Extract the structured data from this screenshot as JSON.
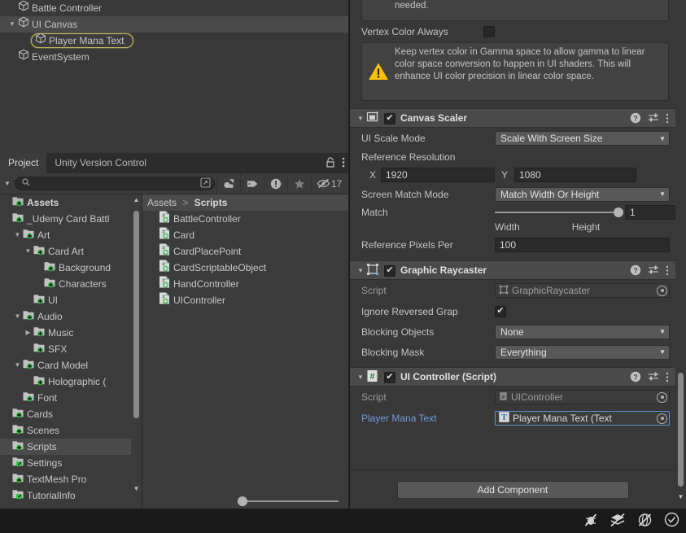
{
  "hierarchy": {
    "rows": [
      {
        "label": "Battle Controller",
        "depth": 1,
        "twisty": "",
        "selected": false
      },
      {
        "label": "UI Canvas",
        "depth": 1,
        "twisty": "▼",
        "selected": false,
        "highlight": true
      },
      {
        "label": "Player Mana Text",
        "depth": 2,
        "twisty": "",
        "selected": true
      },
      {
        "label": "EventSystem",
        "depth": 1,
        "twisty": "",
        "selected": false
      }
    ],
    "gameobject_icon": "cube-icon",
    "selection_outline_color": "#c8bc60"
  },
  "project": {
    "tabs": [
      {
        "label": "Project",
        "active": true
      },
      {
        "label": "Unity Version Control",
        "active": false
      }
    ],
    "tab_icons": [
      "lock-open-icon",
      "kebab-menu-icon"
    ],
    "toolbar": {
      "dropdown_icon": "chevron-down-icon",
      "search_placeholder": "",
      "search_value": "",
      "search_icon": "search-icon",
      "expand_icon": "open-in-new-icon",
      "buttons": [
        {
          "name": "filter-by-type-icon",
          "label": ""
        },
        {
          "name": "filter-by-label-icon",
          "label": ""
        },
        {
          "name": "filter-by-warning-icon",
          "label": ""
        },
        {
          "name": "favorites-star-icon",
          "label": ""
        },
        {
          "name": "hidden-items-icon",
          "label": "17"
        }
      ]
    },
    "tree": [
      {
        "label": "Assets",
        "indent": 0,
        "twisty": "",
        "icon": "assets-folder-icon",
        "bold": true,
        "selected": false
      },
      {
        "label": "_Udemy Card Battl",
        "indent": 0,
        "twisty": "",
        "icon": "folder-icon",
        "bold": false,
        "selected": false
      },
      {
        "label": "Art",
        "indent": 1,
        "twisty": "▼",
        "icon": "folder-icon",
        "bold": false,
        "selected": false
      },
      {
        "label": "Card Art",
        "indent": 2,
        "twisty": "▼",
        "icon": "folder-icon",
        "bold": false,
        "selected": false
      },
      {
        "label": "Background",
        "indent": 3,
        "twisty": "",
        "icon": "folder-icon",
        "bold": false,
        "selected": false
      },
      {
        "label": "Characters",
        "indent": 3,
        "twisty": "",
        "icon": "folder-icon",
        "bold": false,
        "selected": false
      },
      {
        "label": "UI",
        "indent": 2,
        "twisty": "",
        "icon": "folder-icon",
        "bold": false,
        "selected": false
      },
      {
        "label": "Audio",
        "indent": 1,
        "twisty": "▼",
        "icon": "folder-icon",
        "bold": false,
        "selected": false
      },
      {
        "label": "Music",
        "indent": 2,
        "twisty": "▶",
        "icon": "folder-icon",
        "bold": false,
        "selected": false
      },
      {
        "label": "SFX",
        "indent": 2,
        "twisty": "",
        "icon": "folder-icon",
        "bold": false,
        "selected": false
      },
      {
        "label": "Card Model",
        "indent": 1,
        "twisty": "▼",
        "icon": "folder-icon",
        "bold": false,
        "selected": false
      },
      {
        "label": "Holographic (",
        "indent": 2,
        "twisty": "",
        "icon": "folder-icon",
        "bold": false,
        "selected": false
      },
      {
        "label": "Font",
        "indent": 1,
        "twisty": "",
        "icon": "folder-icon",
        "bold": false,
        "selected": false
      },
      {
        "label": "Cards",
        "indent": 0,
        "twisty": "",
        "icon": "folder-icon",
        "bold": false,
        "selected": false
      },
      {
        "label": "Scenes",
        "indent": 0,
        "twisty": "",
        "icon": "folder-icon",
        "bold": false,
        "selected": false
      },
      {
        "label": "Scripts",
        "indent": 0,
        "twisty": "",
        "icon": "folder-icon",
        "bold": false,
        "selected": true
      },
      {
        "label": "Settings",
        "indent": 0,
        "twisty": "",
        "icon": "folder-edit-icon",
        "bold": false,
        "selected": false
      },
      {
        "label": "TextMesh Pro",
        "indent": 0,
        "twisty": "",
        "icon": "folder-icon",
        "bold": false,
        "selected": false
      },
      {
        "label": "TutorialInfo",
        "indent": 0,
        "twisty": "",
        "icon": "folder-edit-icon",
        "bold": false,
        "selected": false
      }
    ],
    "breadcrumb": {
      "root": "Assets",
      "separator": ">",
      "current": "Scripts"
    },
    "files": [
      {
        "label": "BattleController",
        "icon": "csharp-script-icon"
      },
      {
        "label": "Card",
        "icon": "csharp-script-icon"
      },
      {
        "label": "CardPlacePoint",
        "icon": "csharp-script-icon"
      },
      {
        "label": "CardScriptableObject",
        "icon": "csharp-script-icon"
      },
      {
        "label": "HandController",
        "icon": "csharp-script-icon"
      },
      {
        "label": "UIController",
        "icon": "csharp-script-icon"
      }
    ],
    "zoom_slider": {
      "value": 18
    }
  },
  "inspector": {
    "clipped_helpbox_text": "needed.",
    "vertex_color_always": {
      "label": "Vertex Color Always",
      "checked": false
    },
    "vertex_warning": {
      "icon": "warning-triangle-icon",
      "text": "Keep vertex color in Gamma space to allow gamma to linear color space conversion to happen in UI shaders. This will enhance UI color precision in linear color space."
    },
    "canvas_scaler": {
      "title": "Canvas Scaler",
      "icon": "canvas-scaler-icon",
      "enabled": true,
      "foldout": "▼",
      "help_icon": "help-icon",
      "preset_icon": "preset-icon",
      "menu_icon": "kebab-menu-icon",
      "ui_scale_mode": {
        "label": "UI Scale Mode",
        "value": "Scale With Screen Size"
      },
      "reference_resolution": {
        "label": "Reference Resolution",
        "x_label": "X",
        "x_value": "1920",
        "y_label": "Y",
        "y_value": "1080"
      },
      "screen_match_mode": {
        "label": "Screen Match Mode",
        "value": "Match Width Or Height"
      },
      "match": {
        "label": "Match",
        "value": "1",
        "left_label": "Width",
        "right_label": "Height",
        "slider_pct": 100
      },
      "reference_pixels": {
        "label": "Reference Pixels Per",
        "value": "100"
      }
    },
    "graphic_raycaster": {
      "title": "Graphic Raycaster",
      "icon": "graphic-raycaster-icon",
      "enabled": true,
      "foldout": "▼",
      "script": {
        "label": "Script",
        "value": "GraphicRaycaster",
        "icon": "graphic-raycaster-icon"
      },
      "ignore_reversed": {
        "label": "Ignore Reversed Grap",
        "checked": true
      },
      "blocking_objects": {
        "label": "Blocking Objects",
        "value": "None"
      },
      "blocking_mask": {
        "label": "Blocking Mask",
        "value": "Everything"
      }
    },
    "ui_controller": {
      "title": "UI Controller (Script)",
      "icon": "csharp-script-icon",
      "enabled": true,
      "foldout": "▼",
      "script": {
        "label": "Script",
        "value": "UIController",
        "icon": "csharp-script-icon"
      },
      "player_mana_text": {
        "label": "Player Mana Text",
        "value": "Player Mana Text (Text",
        "icon": "text-component-icon"
      }
    },
    "add_component_label": "Add Component"
  },
  "statusbar": {
    "icons": [
      {
        "name": "collab-bug-muted-icon"
      },
      {
        "name": "layers-muted-icon"
      },
      {
        "name": "no-sound-icon"
      },
      {
        "name": "checkmark-circle-icon"
      }
    ]
  }
}
